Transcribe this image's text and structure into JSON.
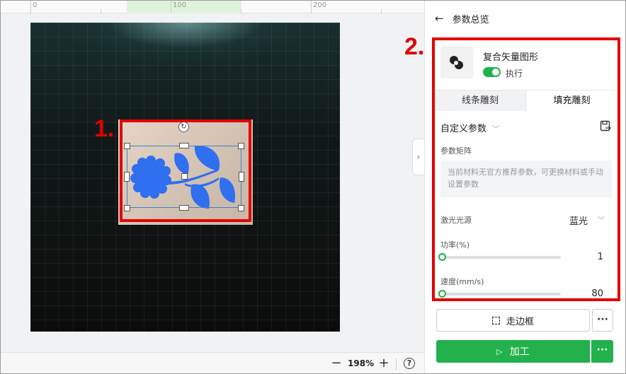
{
  "ruler": {
    "labels": [
      "0",
      "100",
      "200"
    ]
  },
  "canvas": {
    "callout_one": "1.",
    "rotate_icon": "rotate-icon"
  },
  "zoom": {
    "minus": "−",
    "value": "198%",
    "plus": "+",
    "help": "?"
  },
  "panel": {
    "back_icon": "←",
    "title": "参数总览",
    "callout_two": "2.",
    "object": {
      "name": "复合矢量图形",
      "enabled": true,
      "toggle_label": "执行"
    },
    "tabs": [
      {
        "label": "线条雕刻",
        "active": false
      },
      {
        "label": "填充雕刻",
        "active": true
      }
    ],
    "preset_label": "自定义参数",
    "matrix_label": "参数矩阵",
    "matrix_hint": "当前材料无官方推荐参数，可更换材料或手动设置参数",
    "laser": {
      "label": "激光光源",
      "value": "蓝光"
    },
    "power": {
      "label": "功率(%)",
      "value": "1"
    },
    "speed": {
      "label": "速度(mm/s)",
      "value": "80"
    },
    "frame_button": "走边框",
    "process_button": "加工",
    "more": "···"
  },
  "colors": {
    "accent": "#22b14c",
    "callout": "#e30000",
    "art": "#2f6ff0"
  }
}
